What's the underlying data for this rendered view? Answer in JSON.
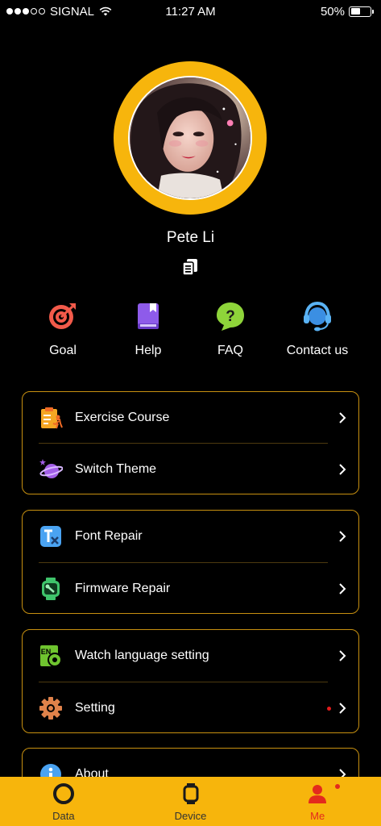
{
  "status_bar": {
    "carrier": "SIGNAL",
    "time": "11:27 AM",
    "battery": "50%",
    "battery_level": 0.5
  },
  "profile": {
    "name": "Pete Li",
    "ring_color": "#f7b50c"
  },
  "quick_actions": [
    {
      "label": "Goal",
      "icon": "target-icon"
    },
    {
      "label": "Help",
      "icon": "book-icon"
    },
    {
      "label": "FAQ",
      "icon": "question-bubble-icon"
    },
    {
      "label": "Contact us",
      "icon": "headset-icon"
    }
  ],
  "menu": {
    "exercise_course": "Exercise Course",
    "switch_theme": "Switch Theme",
    "font_repair": "Font Repair",
    "firmware_repair": "Firmware Repair",
    "watch_language": "Watch language setting",
    "setting": "Setting",
    "about": "About"
  },
  "tab_bar": {
    "data": "Data",
    "device": "Device",
    "me": "Me",
    "active": "Me"
  },
  "colors": {
    "accent": "#f7b50c",
    "card_border": "#c79010",
    "badge": "#e21b1b",
    "active_tab": "#e32a1d"
  }
}
